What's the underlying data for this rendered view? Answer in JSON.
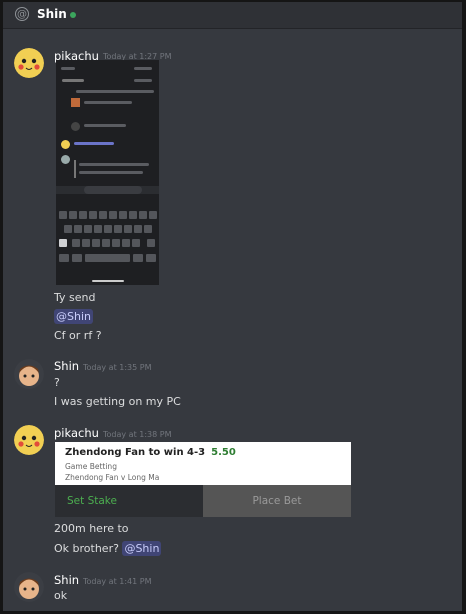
{
  "header": {
    "channel_name": "Shin"
  },
  "messages": [
    {
      "author": "pikachu",
      "timestamp": "Today at 1:27 PM",
      "lines": [
        "Ty send",
        "@Shin",
        "Cf or rf ?"
      ]
    },
    {
      "author": "Shin",
      "timestamp": "Today at 1:35 PM",
      "lines": [
        "?",
        "I was getting on my PC"
      ]
    },
    {
      "author": "pikachu",
      "timestamp": "Today at 1:38 PM",
      "bet_card": {
        "selection": "Zhendong Fan to win 4-3",
        "odds": "5.50",
        "category": "Game Betting",
        "match": "Zhendong Fan v Long Ma",
        "set_stake": "Set Stake",
        "place_bet": "Place Bet"
      },
      "lines": [
        "200m here to",
        "Ok brother?",
        "@Shin"
      ]
    },
    {
      "author": "Shin",
      "timestamp": "Today at 1:41 PM",
      "lines": [
        "ok"
      ]
    }
  ]
}
